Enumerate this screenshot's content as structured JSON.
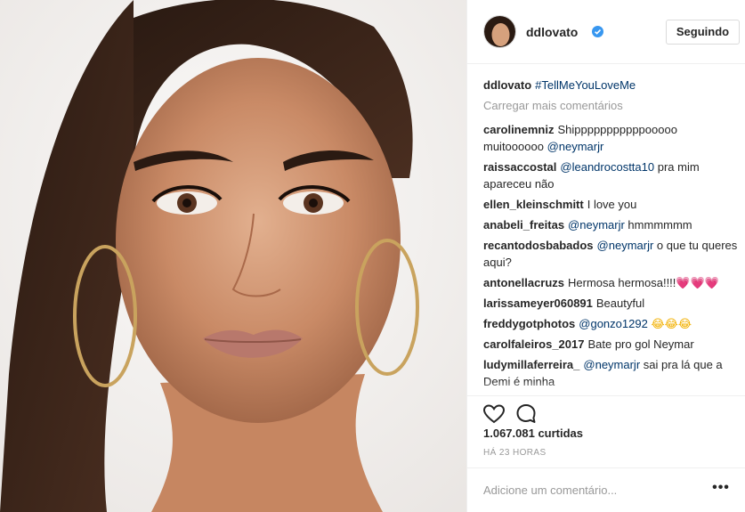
{
  "post": {
    "author": {
      "username": "ddlovato",
      "verified": true,
      "follow_button_label": "Seguindo"
    },
    "caption": {
      "username": "ddlovato",
      "hashtag": "#TellMeYouLoveMe"
    },
    "load_more_label": "Carregar mais comentários",
    "comments": [
      {
        "username": "carolinemniz",
        "parts": [
          {
            "text": "Shipppppppppppooooo muitoooooo "
          },
          {
            "mention": "@neymarjr"
          }
        ]
      },
      {
        "username": "raissaccostal",
        "parts": [
          {
            "mention": "@leandrocostta10"
          },
          {
            "text": " pra mim apareceu não"
          }
        ]
      },
      {
        "username": "ellen_kleinschmitt",
        "parts": [
          {
            "text": "I love you"
          }
        ]
      },
      {
        "username": "anabeli_freitas",
        "parts": [
          {
            "mention": "@neymarjr"
          },
          {
            "text": " hmmmmmm"
          }
        ]
      },
      {
        "username": "recantodosbabados",
        "parts": [
          {
            "mention": "@neymarjr"
          },
          {
            "text": " o que tu queres aqui?"
          }
        ]
      },
      {
        "username": "antonellacruzs",
        "parts": [
          {
            "text": "Hermosa hermosa!!!!"
          },
          {
            "emoji": "💗💗💗"
          }
        ]
      },
      {
        "username": "larissameyer060891",
        "parts": [
          {
            "text": "Beautyful"
          }
        ]
      },
      {
        "username": "freddygotphotos",
        "parts": [
          {
            "mention": "@gonzo1292"
          },
          {
            "text": " "
          },
          {
            "emoji": "😂😂😂"
          }
        ]
      },
      {
        "username": "carolfaleiros_2017",
        "parts": [
          {
            "text": "Bate pro gol Neymar"
          }
        ]
      },
      {
        "username": "ludymillaferreira_",
        "parts": [
          {
            "mention": "@neymarjr"
          },
          {
            "text": " sai pra lá que a Demi é minha"
          }
        ]
      }
    ],
    "likes_label": "1.067.081 curtidas",
    "time_label": "HÁ 23 HORAS",
    "add_comment_placeholder": "Adicione um comentário...",
    "more_options_label": "•••",
    "icons": {
      "like": "heart-outline-icon",
      "comment": "speech-bubble-icon",
      "verified": "verified-badge-icon",
      "more": "more-options-icon"
    },
    "colors": {
      "mention": "#003569",
      "muted": "#999999",
      "verified": "#3897f0",
      "divider": "#efefef"
    }
  }
}
